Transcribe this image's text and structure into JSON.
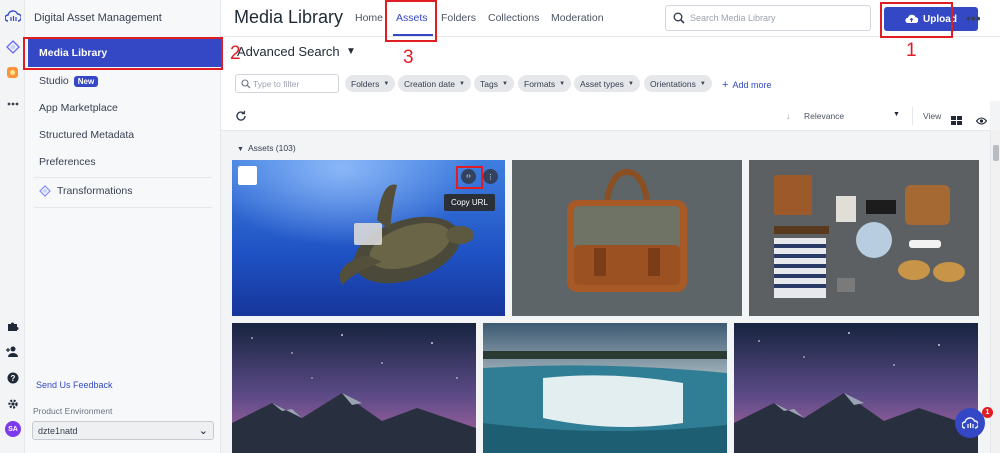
{
  "sidebar": {
    "title": "Digital Asset Management",
    "items": [
      {
        "label": "Media Library"
      },
      {
        "label": "Studio",
        "badge": "New"
      },
      {
        "label": "App Marketplace"
      },
      {
        "label": "Structured Metadata"
      },
      {
        "label": "Preferences"
      },
      {
        "label": "Transformations"
      }
    ],
    "feedback": "Send Us Feedback",
    "env_label": "Product Environment",
    "env_value": "dzte1natd",
    "avatar_initials": "SA"
  },
  "header": {
    "title": "Media Library",
    "tabs": [
      {
        "label": "Home"
      },
      {
        "label": "Assets",
        "active": true
      },
      {
        "label": "Folders"
      },
      {
        "label": "Collections"
      },
      {
        "label": "Moderation"
      }
    ],
    "search_placeholder": "Search Media Library",
    "upload_label": "Upload",
    "more_label": "•••"
  },
  "search": {
    "advanced_label": "Advanced Search",
    "filter_placeholder": "Type to filter",
    "chips": [
      "Folders",
      "Creation date",
      "Tags",
      "Formats",
      "Asset types",
      "Orientations"
    ],
    "add_more": "Add more"
  },
  "results": {
    "sort_label": "Relevance",
    "view_label": "View",
    "assets_header": "Assets (103)",
    "tooltip": "Copy URL"
  },
  "annotations": [
    "1",
    "2",
    "3"
  ],
  "fab_badge": "1",
  "colors": {
    "accent": "#3448c5",
    "annotation": "#e11d24"
  }
}
